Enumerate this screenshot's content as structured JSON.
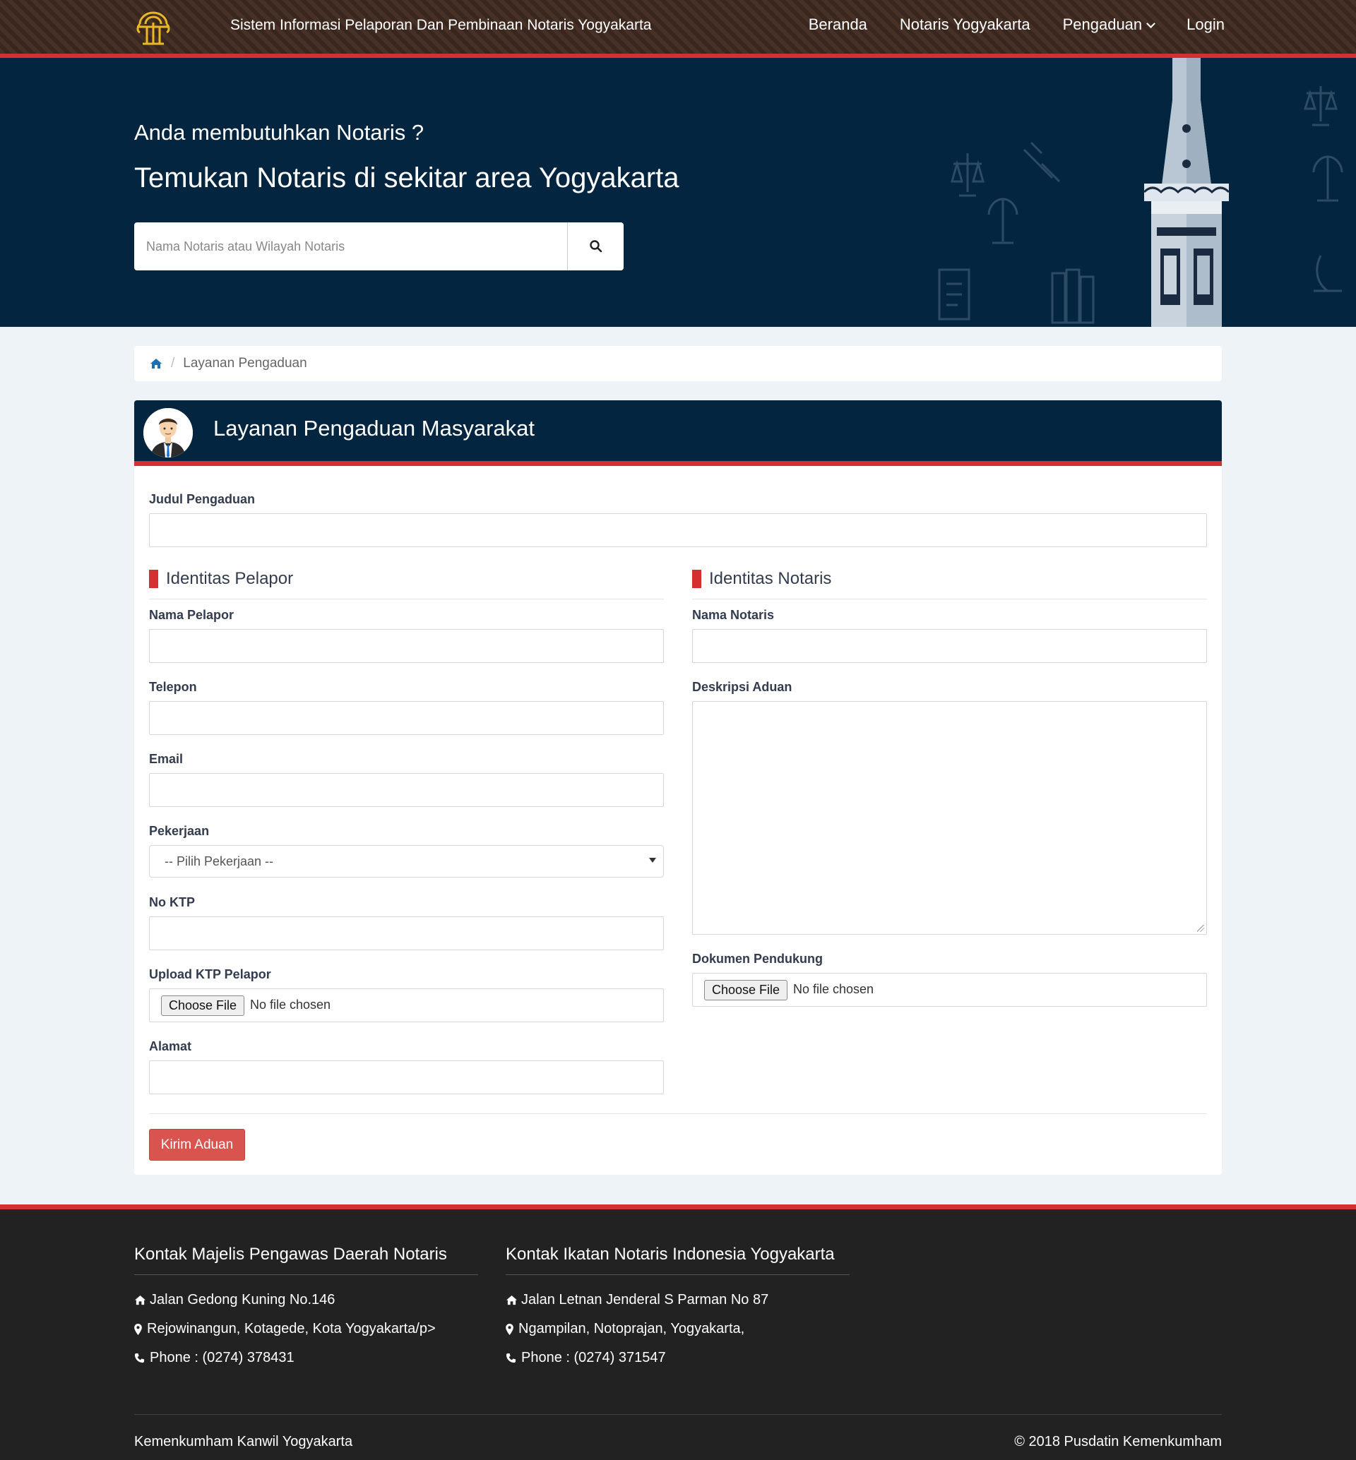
{
  "nav": {
    "title": "Sistem Informasi Pelaporan Dan Pembinaan Notaris Yogyakarta",
    "items": [
      "Beranda",
      "Notaris Yogyakarta",
      "Pengaduan",
      "Login"
    ]
  },
  "hero": {
    "subtitle": "Anda membutuhkan Notaris ?",
    "title": "Temukan Notaris di sekitar area Yogyakarta",
    "search_placeholder": "Nama Notaris atau Wilayah Notaris"
  },
  "breadcrumb": {
    "current": "Layanan Pengaduan"
  },
  "form": {
    "panel_title": "Layanan Pengaduan Masyarakat",
    "judul_label": "Judul Pengaduan",
    "left": {
      "section": "Identitas Pelapor",
      "nama_label": "Nama Pelapor",
      "telepon_label": "Telepon",
      "email_label": "Email",
      "pekerjaan_label": "Pekerjaan",
      "pekerjaan_value": "-- Pilih Pekerjaan --",
      "ktp_label": "No KTP",
      "upload_label": "Upload KTP Pelapor",
      "alamat_label": "Alamat"
    },
    "right": {
      "section": "Identitas Notaris",
      "nama_label": "Nama Notaris",
      "deskripsi_label": "Deskripsi Aduan",
      "dokumen_label": "Dokumen Pendukung"
    },
    "file_button": "Choose File",
    "file_none": "No file chosen",
    "submit": "Kirim Aduan"
  },
  "footer": {
    "col1": {
      "title": "Kontak Majelis Pengawas Daerah Notaris",
      "address": "Jalan Gedong Kuning No.146",
      "area": "Rejowinangun, Kotagede, Kota Yogyakarta/p>",
      "phone": "Phone : (0274) 378431"
    },
    "col2": {
      "title": "Kontak Ikatan Notaris Indonesia Yogyakarta",
      "address": "Jalan Letnan Jenderal S Parman No 87",
      "area": "Ngampilan, Notoprajan, Yogyakarta,",
      "phone": "Phone : (0274) 371547"
    },
    "left": "Kemenkumham Kanwil Yogyakarta",
    "right": "© 2018 Pusdatin Kemenkumham"
  },
  "colors": {
    "navy": "#04253f",
    "accent": "#d3302f",
    "button": "#d9534f",
    "gold": "#e8b923"
  }
}
